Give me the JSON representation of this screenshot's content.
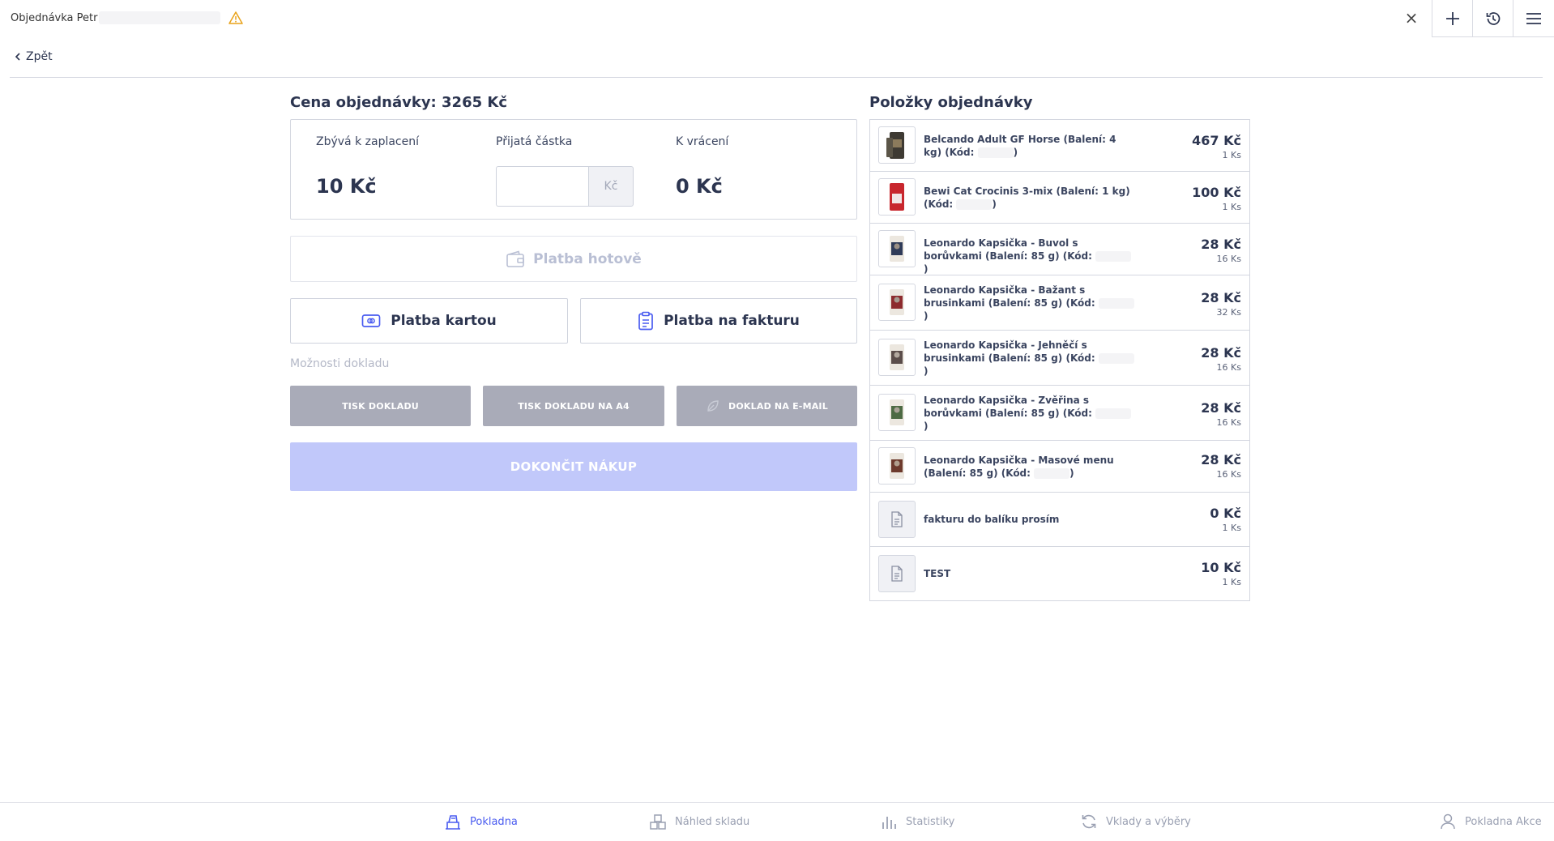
{
  "header": {
    "title": "Objednávka Petr",
    "close_label": "×"
  },
  "back_label": "Zpět",
  "order": {
    "title": "Cena objednávky: 3265 Kč",
    "remaining_label": "Zbývá k zaplacení",
    "remaining_value": "10 Kč",
    "received_label": "Přijatá částka",
    "received_value": "",
    "received_unit": "Kč",
    "change_label": "K vrácení",
    "change_value": "0 Kč"
  },
  "payments": {
    "cash": "Platba hotově",
    "card": "Platba kartou",
    "invoice": "Platba na fakturu"
  },
  "receipt": {
    "options_label": "Možnosti dokladu",
    "print": "TISK DOKLADU",
    "print_a4": "TISK DOKLADU NA A4",
    "email": "DOKLAD NA E-MAIL"
  },
  "finish_label": "DOKONČIT NÁKUP",
  "items_title": "Položky objednávky",
  "items": [
    {
      "name": "Belcando Adult GF Horse (Balení: 4 kg) (Kód:",
      "name_end": ")",
      "price": "467 Kč",
      "qty": "1 Ks",
      "thumb": "dark-bag"
    },
    {
      "name": "Bewi Cat Crocinis 3-mix (Balení: 1 kg) (Kód:",
      "name_end": ")",
      "price": "100 Kč",
      "qty": "1 Ks",
      "thumb": "red-bag"
    },
    {
      "name": "Leonardo Kapsička - Buvol s borůvkami (Balení: 85 g) (Kód:",
      "name_end": ")",
      "price": "28 Kč",
      "qty": "16 Ks",
      "thumb": "pouch-blue"
    },
    {
      "name": "Leonardo Kapsička - Bažant s brusinkami (Balení: 85 g) (Kód:",
      "name_end": ")",
      "price": "28 Kč",
      "qty": "32 Ks",
      "thumb": "pouch-red"
    },
    {
      "name": "Leonardo Kapsička - Jehněčí s brusinkami (Balení: 85 g) (Kód:",
      "name_end": ")",
      "price": "28 Kč",
      "qty": "16 Ks",
      "thumb": "pouch-grey"
    },
    {
      "name": "Leonardo Kapsička - Zvěřina s borůvkami (Balení: 85 g) (Kód:",
      "name_end": ")",
      "price": "28 Kč",
      "qty": "16 Ks",
      "thumb": "pouch-green"
    },
    {
      "name": "Leonardo Kapsička - Masové menu (Balení: 85 g) (Kód:",
      "name_end": ")",
      "price": "28 Kč",
      "qty": "16 Ks",
      "thumb": "pouch-brown"
    },
    {
      "name": "fakturu do balíku prosím",
      "name_end": "",
      "price": "0 Kč",
      "qty": "1 Ks",
      "thumb": "document-icon"
    },
    {
      "name": "TEST",
      "name_end": "",
      "price": "10 Kč",
      "qty": "1 Ks",
      "thumb": "document-icon"
    }
  ],
  "nav": {
    "register": "Pokladna",
    "stock": "Náhled skladu",
    "stats": "Statistiky",
    "deposits": "Vklady a výběry",
    "actions": "Pokladna Akce"
  },
  "colors": {
    "accent": "#4a5cf0",
    "finish_disabled": "#c1c8fa",
    "grey_button": "#a9abb8",
    "warning": "#e8a21a"
  }
}
